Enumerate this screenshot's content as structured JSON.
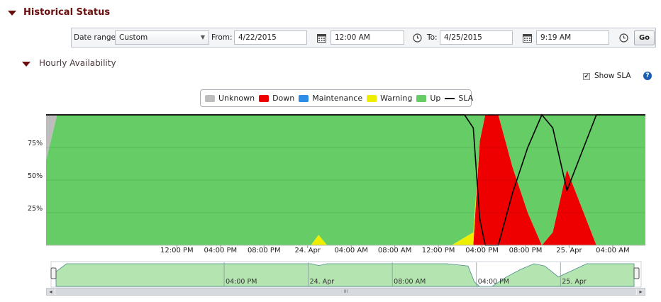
{
  "section": {
    "title": "Historical Status"
  },
  "toolbar": {
    "date_range_label": "Date range:",
    "date_range_value": "Custom",
    "from_label": "From:",
    "from_date": "4/22/2015",
    "from_time": "12:00 AM",
    "to_label": "To:",
    "to_date": "4/25/2015",
    "to_time": "9:19 AM",
    "go_label": "Go"
  },
  "subsection": {
    "title": "Hourly Availability"
  },
  "show_sla": {
    "label": "Show SLA",
    "checked": true
  },
  "help_icon": "?",
  "colors": {
    "unknown": "#bdbdbd",
    "down": "#ee0000",
    "maintenance": "#2c8ee8",
    "warning": "#eeee00",
    "up": "#66cc66",
    "sla": "#000000",
    "header": "#6b0e0e"
  },
  "chart_data": {
    "type": "area",
    "stacked": true,
    "legend": [
      "Unknown",
      "Down",
      "Maintenance",
      "Warning",
      "Up",
      "SLA"
    ],
    "legend_position": "top-center",
    "ytick_labels": [
      "25%",
      "50%",
      "75%"
    ],
    "ylim": [
      0,
      100
    ],
    "xtick_labels": [
      "12:00 PM",
      "04:00 PM",
      "08:00 PM",
      "24. Apr",
      "04:00 AM",
      "08:00 AM",
      "12:00 PM",
      "04:00 PM",
      "08:00 PM",
      "25. Apr",
      "04:00 AM"
    ],
    "xtick_hours": [
      12,
      16,
      20,
      24,
      28,
      32,
      36,
      40,
      44,
      48,
      52
    ],
    "x_hours_range": [
      0,
      55
    ],
    "series": [
      {
        "name": "Unknown",
        "x": [
          0,
          1,
          55
        ],
        "values": [
          35,
          0,
          0
        ]
      },
      {
        "name": "Down",
        "x": [
          0,
          38.4,
          39.2,
          39.8,
          40.3,
          41.5,
          42.8,
          44.2,
          45.5,
          46.5,
          47.8,
          50.5,
          55
        ],
        "values": [
          0,
          0,
          0,
          80,
          100,
          100,
          60,
          25,
          0,
          10,
          58,
          0,
          0
        ]
      },
      {
        "name": "Warning",
        "x": [
          0,
          24.3,
          25,
          25.8,
          37.2,
          38.4,
          39.2,
          39.8,
          40.3,
          55
        ],
        "values": [
          0,
          0,
          8,
          0,
          0,
          6,
          10,
          0,
          0,
          0
        ]
      },
      {
        "name": "Up",
        "x": [
          0,
          1,
          24.3,
          25,
          25.8,
          37.2,
          38.4,
          39.2,
          39.8,
          40.3,
          41.5,
          42.8,
          44.2,
          45.5,
          46.5,
          47.8,
          50.5,
          55
        ],
        "values": [
          65,
          100,
          100,
          92,
          100,
          100,
          94,
          90,
          20,
          0,
          0,
          40,
          75,
          100,
          90,
          42,
          100,
          100
        ]
      },
      {
        "name": "SLA",
        "x": [
          0,
          38.4,
          39.2,
          39.8,
          40.3,
          41.5,
          42.8,
          44.2,
          45.5,
          46.5,
          47.8,
          50.5,
          55
        ],
        "values": [
          100,
          100,
          90,
          20,
          0,
          0,
          40,
          75,
          100,
          90,
          42,
          100,
          100
        ]
      }
    ],
    "navigator": {
      "xtick_labels": [
        "04:00 PM",
        "24. Apr",
        "08:00 AM",
        "04:00 PM",
        "25. Apr"
      ],
      "xtick_hours": [
        16,
        24,
        32,
        40,
        48
      ],
      "x": [
        0,
        1,
        24.3,
        25,
        25.8,
        37.2,
        38.4,
        39.2,
        39.8,
        40.3,
        41.5,
        42.8,
        44.2,
        45.5,
        46.5,
        47.8,
        50.5,
        55
      ],
      "values": [
        65,
        100,
        100,
        92,
        100,
        100,
        94,
        90,
        20,
        0,
        0,
        40,
        75,
        100,
        90,
        42,
        100,
        100
      ]
    }
  },
  "scrollbar": {
    "left_arrow": "◂",
    "right_arrow": "▸",
    "grip": "III"
  }
}
